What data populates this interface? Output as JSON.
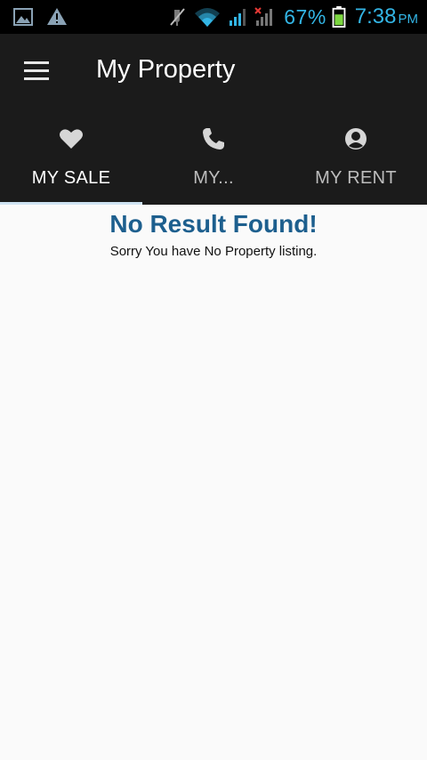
{
  "status_bar": {
    "left_icons": [
      "gallery-icon",
      "warning-icon"
    ],
    "right_icons": [
      "mute-icon",
      "wifi-icon",
      "signal-icon",
      "signal-no-data-icon",
      "battery-icon"
    ],
    "battery_percent": "67%",
    "time": "7:38",
    "ampm": "PM",
    "accent_color": "#33b5e5"
  },
  "action_bar": {
    "menu_icon": "hamburger-menu-icon",
    "title": "My Property"
  },
  "tabs": [
    {
      "label": "MY SALE",
      "icon": "heart-icon",
      "active": true
    },
    {
      "label": "MY...",
      "icon": "phone-icon",
      "active": false
    },
    {
      "label": "MY RENT",
      "icon": "person-icon",
      "active": false
    }
  ],
  "empty_state": {
    "title": "No Result Found!",
    "message": "Sorry You have No Property listing.",
    "title_color": "#1d5f8e"
  }
}
